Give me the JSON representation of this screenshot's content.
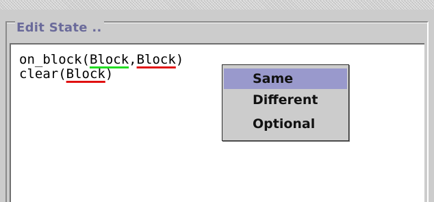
{
  "group": {
    "title": "Edit State .."
  },
  "editor": {
    "line1": {
      "prefix": "on_block(",
      "arg1": "Block",
      "separator": ",",
      "arg2": "Block",
      "suffix": ")"
    },
    "line2": {
      "prefix": "clear(",
      "arg1": "Block",
      "suffix": ")"
    }
  },
  "popup_menu": {
    "items": [
      {
        "label": "Same",
        "selected": true
      },
      {
        "label": "Different",
        "selected": false
      },
      {
        "label": "Optional",
        "selected": false
      }
    ]
  },
  "colors": {
    "selected_item_bg": "#9999cc",
    "title_text": "#6a6a9a",
    "underline_green": "#22dd22",
    "underline_red": "#e01010"
  }
}
